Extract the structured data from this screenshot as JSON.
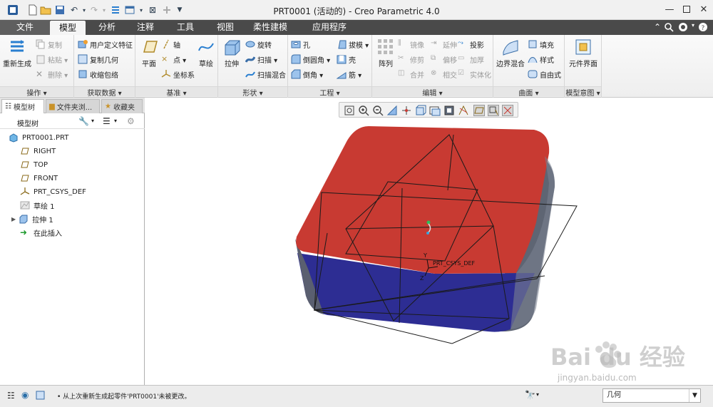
{
  "window": {
    "title": "PRT0001 (活动的) - Creo Parametric 4.0"
  },
  "tabs": [
    {
      "label": "文件"
    },
    {
      "label": "模型"
    },
    {
      "label": "分析"
    },
    {
      "label": "注释"
    },
    {
      "label": "工具"
    },
    {
      "label": "视图"
    },
    {
      "label": "柔性建模"
    },
    {
      "label": "应用程序"
    }
  ],
  "ribbon": {
    "operations": {
      "label": "操作 ▾",
      "regenerate": "重新生成",
      "copy": "复制",
      "paste": "粘贴 ▾",
      "delete": "删除 ▾"
    },
    "get_data": {
      "label": "获取数据 ▾",
      "udf": "用户定义特征",
      "copy_geom": "复制几何",
      "shrinkwrap": "收缩包络"
    },
    "datum": {
      "label": "基准 ▾",
      "plane": "平面",
      "axis": "轴",
      "point": "点 ▾",
      "csys": "坐标系",
      "sketch": "草绘"
    },
    "shapes": {
      "label": "形状 ▾",
      "extrude": "拉伸",
      "revolve": "旋转",
      "sweep": "扫描 ▾",
      "swept_blend": "扫描混合"
    },
    "engineering": {
      "label": "工程 ▾",
      "hole": "孔",
      "draft": "拔模 ▾",
      "round": "倒圆角 ▾",
      "shell": "壳",
      "chamfer": "倒角 ▾",
      "rib": "筋 ▾"
    },
    "editing": {
      "label": "编辑 ▾",
      "pattern": "阵列",
      "mirror": "镜像",
      "extend": "延伸",
      "project": "投影",
      "trim": "修剪",
      "offset": "偏移",
      "thicken": "加厚",
      "merge": "合并",
      "intersect": "相交",
      "solidify": "实体化"
    },
    "surfaces": {
      "label": "曲面 ▾",
      "boundary_blend": "边界混合",
      "fill": "填充",
      "style": "样式",
      "freestyle": "自由式"
    },
    "model_intent": {
      "label": "模型意图 ▾",
      "component_interface": "元件界面"
    }
  },
  "left_panel": {
    "tabs": [
      {
        "label": "模型树"
      },
      {
        "label": "文件夹浏..."
      },
      {
        "label": "收藏夹"
      }
    ],
    "tree_header": "模型树",
    "tree_items": [
      {
        "label": "PRT0001.PRT"
      },
      {
        "label": "RIGHT"
      },
      {
        "label": "TOP"
      },
      {
        "label": "FRONT"
      },
      {
        "label": "PRT_CSYS_DEF"
      },
      {
        "label": "草绘 1"
      },
      {
        "label": "拉伸 1"
      },
      {
        "label": "在此插入"
      }
    ]
  },
  "graphics": {
    "csys_label": "PRT_CSYS_DEF",
    "axis_y": "Y",
    "axis_z": "Z",
    "colors": {
      "top_face": "#c83a32",
      "front_face": "#2d2d93",
      "side_face": "#5e6573"
    }
  },
  "status": {
    "message": "• 从上次重新生成起零件'PRT0001'未被更改。",
    "filter": "几何"
  },
  "watermark": {
    "brand": "Bai du 经验",
    "url": "jingyan.baidu.com"
  }
}
